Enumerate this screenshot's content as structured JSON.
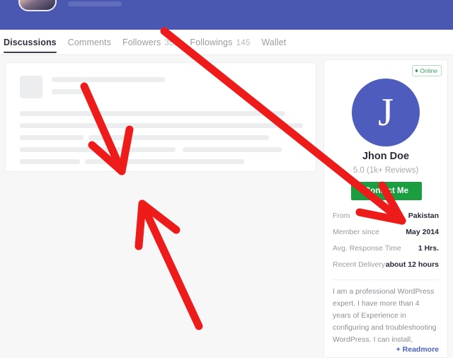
{
  "banner": {
    "avatar_icon": "user-photo-avatar"
  },
  "tabs": [
    {
      "label": "Discussions",
      "count": "",
      "active": true
    },
    {
      "label": "Comments",
      "count": "",
      "active": false
    },
    {
      "label": "Followers",
      "count": "352",
      "active": false
    },
    {
      "label": "Followings",
      "count": "145",
      "active": false
    },
    {
      "label": "Wallet",
      "count": "",
      "active": false
    }
  ],
  "feed": {
    "skeleton_placeholder": true
  },
  "profile": {
    "online_label": "Online",
    "avatar_initial": "J",
    "name": "Jhon Doe",
    "rating": "5.0 (1k+ Reviews)",
    "contact_label": "Contact Me",
    "details": [
      {
        "label": "From",
        "value": "Pakistan"
      },
      {
        "label": "Member since",
        "value": "May 2014"
      },
      {
        "label": "Avg. Response Time",
        "value": "1 Hrs."
      },
      {
        "label": "Recent Delivery",
        "value": "about 12 hours"
      }
    ],
    "bio": "I am a professional WordPress expert. I have more than 4 years of Experience in configuring and troubleshooting WordPress. I can install,",
    "readmore_label": "+ Readmore"
  },
  "colors": {
    "banner": "#4b58b2",
    "avatar": "#4d5cbd",
    "contact_button": "#1a9e3f",
    "online": "#2f9e4f",
    "annotation": "#ee1b1b",
    "page_background": "#f7f7f8"
  },
  "annotations": {
    "arrow_long_label": "arrow-to-member-details",
    "arrow_down_label": "arrow-to-feed-card",
    "arrow_up_label": "arrow-to-feed-area"
  }
}
